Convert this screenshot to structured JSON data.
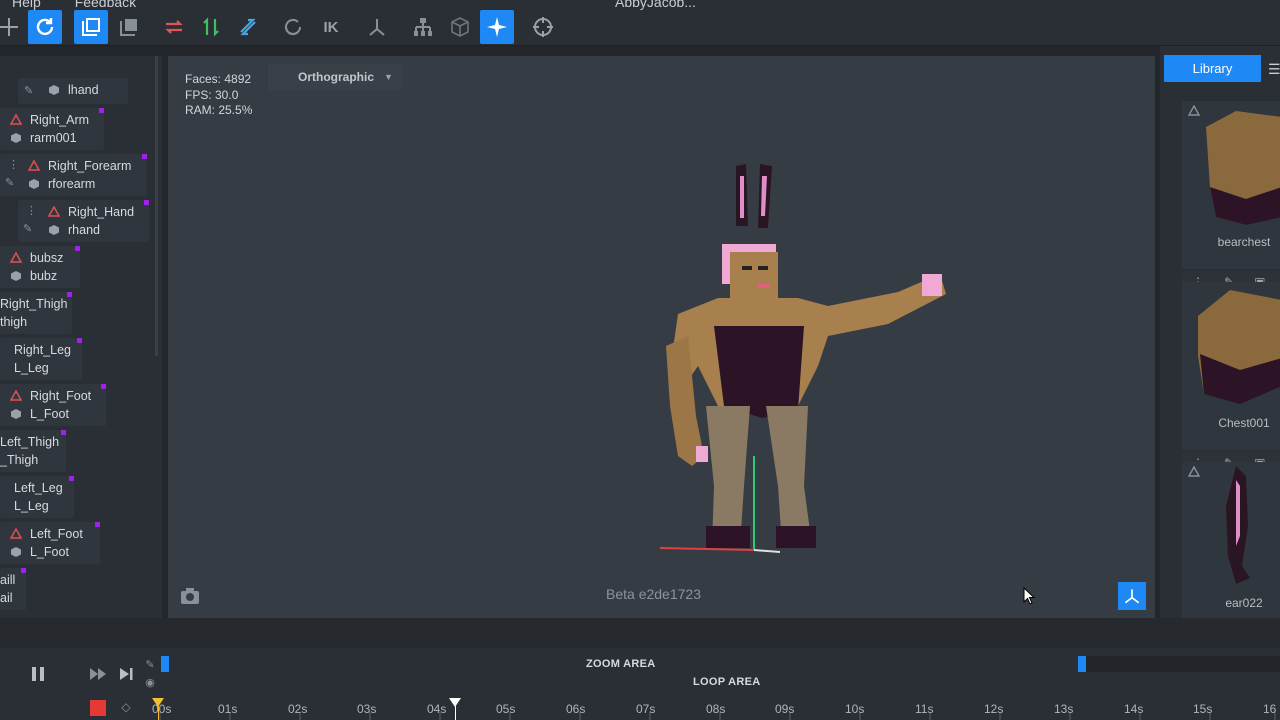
{
  "menu": {
    "items": [
      "Help",
      "Feedback"
    ],
    "app_title": "AbbyJacob..."
  },
  "toolbar": {
    "ik_label": "IK"
  },
  "hierarchy": {
    "nodes": [
      {
        "bone": "",
        "mesh": "lhand"
      },
      {
        "bone": "Right_Arm",
        "mesh": "rarm001"
      },
      {
        "bone": "Right_Forearm",
        "mesh": "rforearm"
      },
      {
        "bone": "Right_Hand",
        "mesh": "rhand"
      },
      {
        "bone": "bubsz",
        "mesh": "bubz"
      },
      {
        "bone": "Right_Thigh",
        "mesh": "thigh"
      },
      {
        "bone": "Right_Leg",
        "mesh": "L_Leg"
      },
      {
        "bone": "Right_Foot",
        "mesh": "L_Foot"
      },
      {
        "bone": "Left_Thigh",
        "mesh": "_Thigh"
      },
      {
        "bone": "Left_Leg",
        "mesh": "L_Leg"
      },
      {
        "bone": "Left_Foot",
        "mesh": "L_Foot"
      },
      {
        "bone": "aill",
        "mesh": "ail"
      }
    ]
  },
  "viewport": {
    "faces": "Faces: 4892",
    "fps": "FPS: 30.0",
    "ram": "RAM: 25.5%",
    "projection": "Orthographic",
    "version": "Beta e2de1723"
  },
  "library": {
    "tab": "Library",
    "items": [
      {
        "name": "bearchest"
      },
      {
        "name": "Chest001"
      },
      {
        "name": "ear022"
      }
    ]
  },
  "timeline": {
    "zoom_area": "ZOOM AREA",
    "loop_area": "LOOP AREA",
    "ticks": [
      "00s",
      "01s",
      "02s",
      "03s",
      "04s",
      "05s",
      "06s",
      "07s",
      "08s",
      "09s",
      "10s",
      "11s",
      "12s",
      "13s",
      "14s",
      "15s",
      "16"
    ]
  },
  "colors": {
    "accent": "#1e88f5",
    "record": "#e53935",
    "bone": "#e05050",
    "flag": "#a020f0"
  }
}
